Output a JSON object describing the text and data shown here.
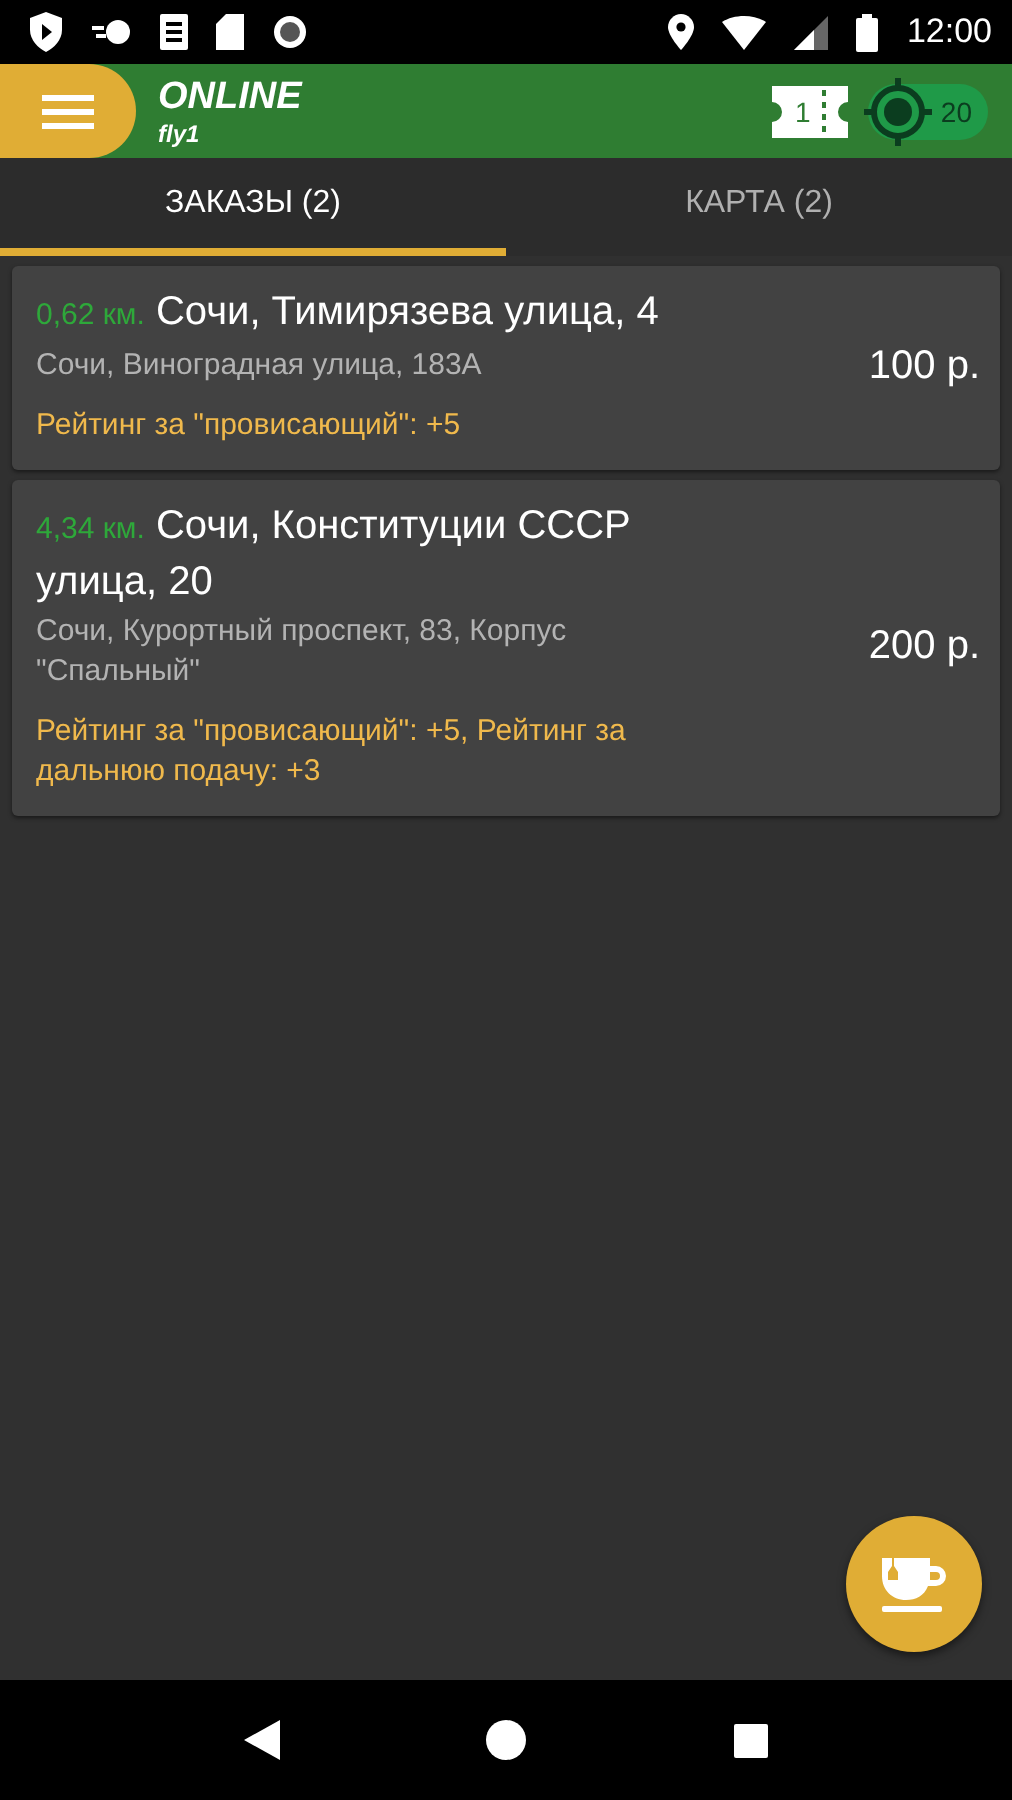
{
  "status_bar": {
    "time": "12:00"
  },
  "header": {
    "title": "ONLINE",
    "subtitle": "fly1",
    "ticket_count": "1",
    "gps_count": "20"
  },
  "tabs": [
    {
      "label": "ЗАКАЗЫ (2)",
      "selected": true
    },
    {
      "label": "КАРТА (2)",
      "selected": false
    }
  ],
  "orders": [
    {
      "distance": "0,62 км.",
      "address": "Сочи, Тимирязева улица, 4",
      "destination": "Сочи, Виноградная улица, 183А",
      "bonus": "Рейтинг за \"провисающий\": +5",
      "price": "100 р."
    },
    {
      "distance": "4,34 км.",
      "address": "Сочи, Конституции СССР улица, 20",
      "destination": "Сочи, Курортный проспект, 83, Корпус \"Спальный\"",
      "bonus": "Рейтинг за \"провисающий\": +5, Рейтинг за дальнюю подачу: +3",
      "price": "200 р."
    }
  ]
}
